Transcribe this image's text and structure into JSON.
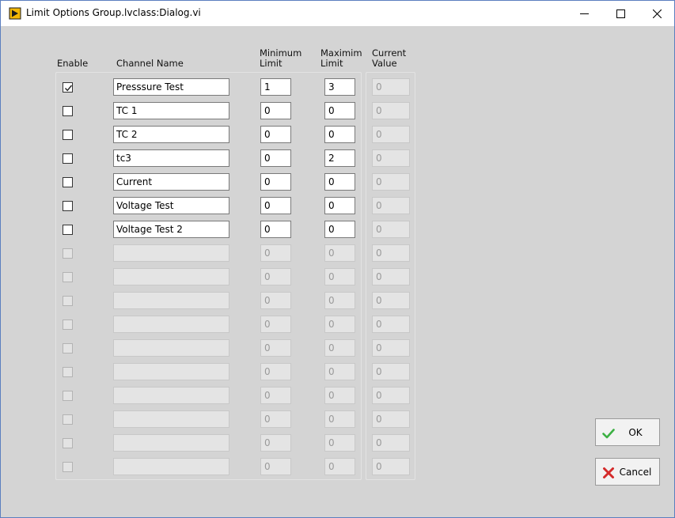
{
  "window": {
    "title": "Limit Options Group.lvclass:Dialog.vi",
    "controls": [
      "minimize-icon",
      "maximize-icon",
      "close-icon"
    ]
  },
  "headers": {
    "enable": "Enable",
    "channel_name": "Channel Name",
    "min_limit_1": "Minimum",
    "min_limit_2": "Limit",
    "max_limit_1": "Maximim",
    "max_limit_2": "Limit",
    "current_1": "Current",
    "current_2": "Value"
  },
  "rows": [
    {
      "enabled": true,
      "checked": true,
      "name": "Presssure Test",
      "min": "1",
      "max": "3",
      "current": "0"
    },
    {
      "enabled": true,
      "checked": false,
      "name": "TC 1",
      "min": "0",
      "max": "0",
      "current": "0"
    },
    {
      "enabled": true,
      "checked": false,
      "name": "TC 2",
      "min": "0",
      "max": "0",
      "current": "0"
    },
    {
      "enabled": true,
      "checked": false,
      "name": "tc3",
      "min": "0",
      "max": "2",
      "current": "0"
    },
    {
      "enabled": true,
      "checked": false,
      "name": "Current",
      "min": "0",
      "max": "0",
      "current": "0"
    },
    {
      "enabled": true,
      "checked": false,
      "name": "Voltage Test",
      "min": "0",
      "max": "0",
      "current": "0"
    },
    {
      "enabled": true,
      "checked": false,
      "name": "Voltage Test 2",
      "min": "0",
      "max": "0",
      "current": "0"
    },
    {
      "enabled": false,
      "checked": false,
      "name": "",
      "min": "0",
      "max": "0",
      "current": "0"
    },
    {
      "enabled": false,
      "checked": false,
      "name": "",
      "min": "0",
      "max": "0",
      "current": "0"
    },
    {
      "enabled": false,
      "checked": false,
      "name": "",
      "min": "0",
      "max": "0",
      "current": "0"
    },
    {
      "enabled": false,
      "checked": false,
      "name": "",
      "min": "0",
      "max": "0",
      "current": "0"
    },
    {
      "enabled": false,
      "checked": false,
      "name": "",
      "min": "0",
      "max": "0",
      "current": "0"
    },
    {
      "enabled": false,
      "checked": false,
      "name": "",
      "min": "0",
      "max": "0",
      "current": "0"
    },
    {
      "enabled": false,
      "checked": false,
      "name": "",
      "min": "0",
      "max": "0",
      "current": "0"
    },
    {
      "enabled": false,
      "checked": false,
      "name": "",
      "min": "0",
      "max": "0",
      "current": "0"
    },
    {
      "enabled": false,
      "checked": false,
      "name": "",
      "min": "0",
      "max": "0",
      "current": "0"
    },
    {
      "enabled": false,
      "checked": false,
      "name": "",
      "min": "0",
      "max": "0",
      "current": "0"
    }
  ],
  "buttons": {
    "ok_label": "OK",
    "ok_icon": "checkmark-icon",
    "cancel_label": "Cancel",
    "cancel_icon": "x-mark-icon"
  },
  "colors": {
    "ok_check": "#3cb043",
    "cancel_x": "#d42a2a",
    "labview_icon": "#f2b705"
  }
}
